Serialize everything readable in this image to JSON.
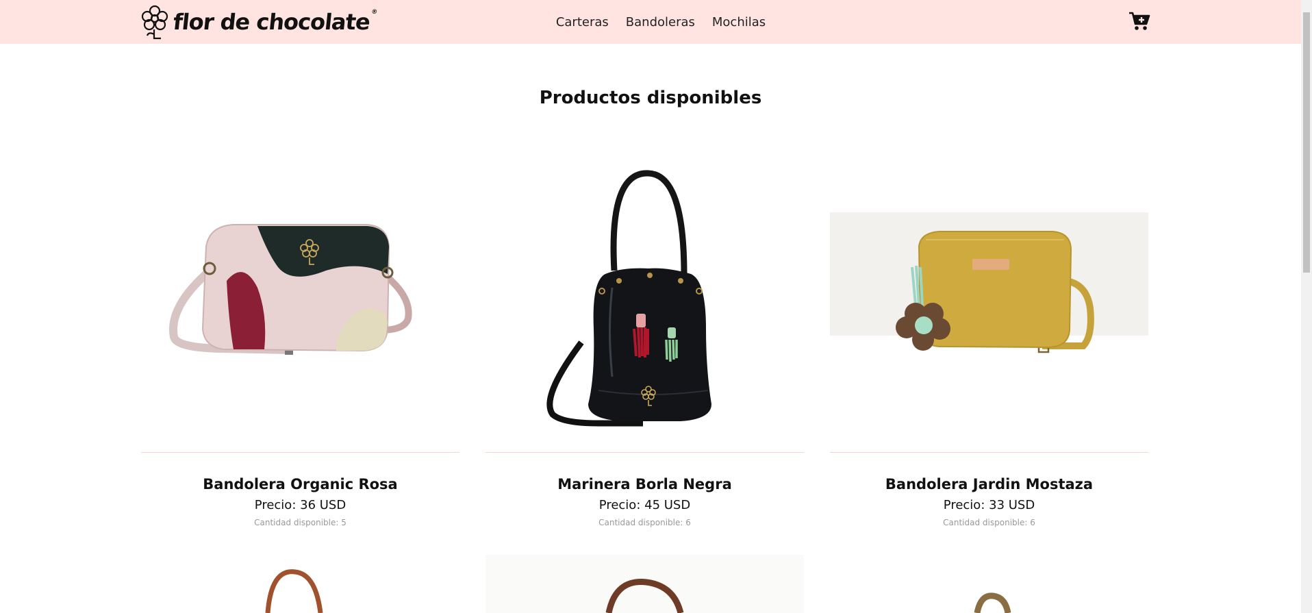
{
  "brand": {
    "logo_text": "flor de chocolate",
    "reg_mark": "®"
  },
  "nav": {
    "items": [
      "Carteras",
      "Bandoleras",
      "Mochilas"
    ]
  },
  "icons": {
    "cart": "cart-plus-icon",
    "logo": "flower-logo-icon"
  },
  "colors": {
    "navbar_bg": "#ffe4e1",
    "divider": "#f3d5cc",
    "qty_text": "#999999"
  },
  "main": {
    "title": "Productos disponibles"
  },
  "products": [
    {
      "name": "Bandolera Organic Rosa",
      "price": "Precio: 36 USD",
      "qty": "Cantidad disponible: 5"
    },
    {
      "name": "Marinera Borla Negra",
      "price": "Precio: 45 USD",
      "qty": "Cantidad disponible: 6"
    },
    {
      "name": "Bandolera Jardin Mostaza",
      "price": "Precio: 33 USD",
      "qty": "Cantidad disponible: 6"
    }
  ]
}
